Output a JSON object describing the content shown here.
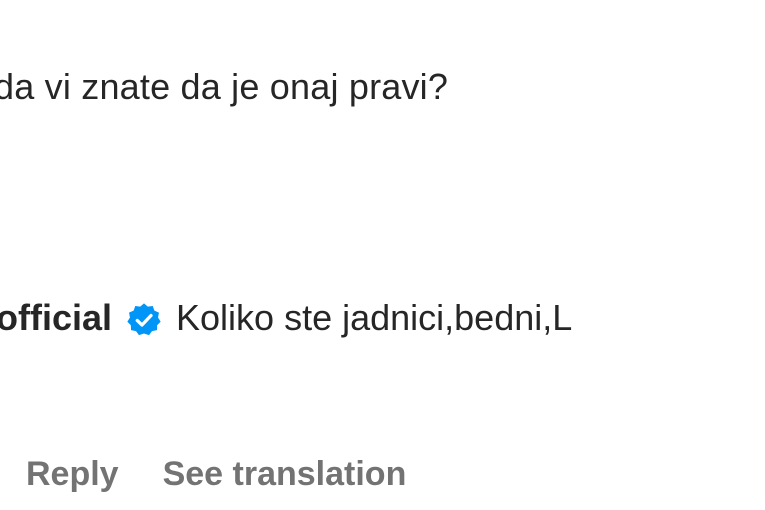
{
  "comment": {
    "text": "da vi znate da je onaj pravi?"
  },
  "reply": {
    "username": "official",
    "text": "Koliko ste jadnici,bedni,L"
  },
  "actions": {
    "reply_label": "Reply",
    "translate_label": "See translation"
  },
  "colors": {
    "text": "#262626",
    "secondary": "#737373",
    "verified": "#0095f6"
  },
  "icons": {
    "verified": "verified-badge-icon"
  }
}
